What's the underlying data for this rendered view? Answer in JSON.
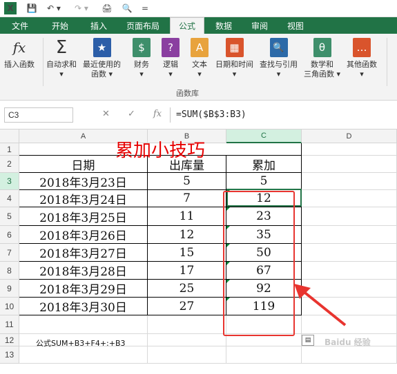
{
  "qat": {
    "logo": "X",
    "save": "💾",
    "undo": "↶ ▾",
    "redo": "↷ ▾",
    "print": "🖨",
    "preview": "🔍",
    "more": "="
  },
  "tabs": [
    "文件",
    "开始",
    "插入",
    "页面布局",
    "公式",
    "数据",
    "审阅",
    "视图"
  ],
  "ribbon": {
    "buttons": [
      {
        "label": "插入函数",
        "icon": "fx",
        "color": "#ffffff"
      },
      {
        "label": "自动求和\n▾",
        "icon": "Σ",
        "color": "#ffffff"
      },
      {
        "label": "最近使用的\n函数 ▾",
        "icon": "★",
        "color": "#2c5ea8"
      },
      {
        "label": "财务\n▾",
        "icon": "$",
        "color": "#3e8f6b"
      },
      {
        "label": "逻辑\n▾",
        "icon": "?",
        "color": "#8a3fa0"
      },
      {
        "label": "文本\n▾",
        "icon": "A",
        "color": "#e8a33d"
      },
      {
        "label": "日期和时间\n▾",
        "icon": "▦",
        "color": "#d9542c"
      },
      {
        "label": "查找与引用\n▾",
        "icon": "🔍",
        "color": "#2c6aa8"
      },
      {
        "label": "数学和\n三角函数 ▾",
        "icon": "θ",
        "color": "#3e8f6b"
      },
      {
        "label": "其他函数\n▾",
        "icon": "…",
        "color": "#d9542c"
      }
    ],
    "group_label": "函数库"
  },
  "formula_bar": {
    "name_box": "C3",
    "cancel": "✕",
    "enter": "✓",
    "fx": "fx",
    "formula": "=SUM($B$3:B3)"
  },
  "columns": [
    "A",
    "B",
    "C",
    "D"
  ],
  "rows": [
    "1",
    "2",
    "3",
    "4",
    "5",
    "6",
    "7",
    "8",
    "9",
    "10",
    "11",
    "12",
    "13"
  ],
  "sheet": {
    "title": "累加小技巧",
    "headers": [
      "日期",
      "出库量",
      "累加"
    ],
    "data": [
      [
        "2018年3月23日",
        "5",
        "5"
      ],
      [
        "2018年3月24日",
        "7",
        "12"
      ],
      [
        "2018年3月25日",
        "11",
        "23"
      ],
      [
        "2018年3月26日",
        "12",
        "35"
      ],
      [
        "2018年3月27日",
        "15",
        "50"
      ],
      [
        "2018年3月28日",
        "17",
        "67"
      ],
      [
        "2018年3月29日",
        "25",
        "92"
      ],
      [
        "2018年3月30日",
        "27",
        "119"
      ]
    ],
    "note": "公式SUM+B3+F4+:+B3"
  },
  "watermark": "Baidu 经验"
}
